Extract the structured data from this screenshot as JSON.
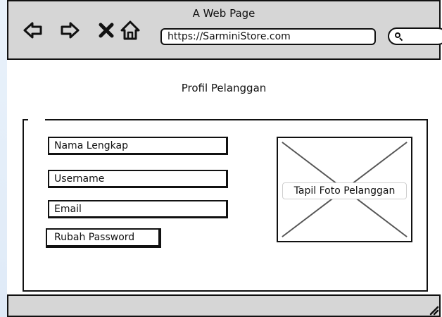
{
  "window": {
    "title": "A Web Page"
  },
  "browser": {
    "url": "https://SarminiStore.com",
    "icons": [
      "back-icon",
      "forward-icon",
      "close-icon",
      "home-icon",
      "search-icon",
      "resize-grip-icon"
    ]
  },
  "page": {
    "title": "Profil Pelanggan"
  },
  "profile_form": {
    "full_name_field": "Nama Lengkap",
    "username_field": "Username",
    "email_field": "Email",
    "change_password_button": "Rubah Password",
    "photo_label": "Tapil Foto Pelanggan"
  }
}
